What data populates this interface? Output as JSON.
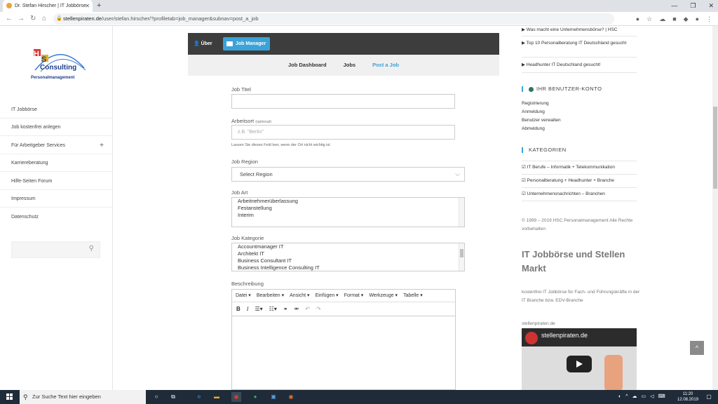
{
  "browser": {
    "tab_title": "Dr. Stefan Hirscher | IT Jobbörse",
    "new_tab": "+",
    "url_host": "stellenpiraten.de",
    "url_path": "/user/stefan.hirscher/?profiletab=job_manager&subnav=post_a_job"
  },
  "left": {
    "logo_top": "HS",
    "logo_main": "Consulting",
    "logo_sub": "Personalmanagement",
    "menu": [
      {
        "label": "IT Jobbörse"
      },
      {
        "label": "Job kostenfrei anlegen"
      },
      {
        "label": "Für Arbeitgeber Services",
        "extra": "+"
      },
      {
        "label": "Karriereberatung"
      },
      {
        "label": "Hilfe-Seiten Forum"
      },
      {
        "label": "Impressum"
      },
      {
        "label": "Datenschutz"
      }
    ]
  },
  "center": {
    "tabs": {
      "ueber": "Über",
      "job_manager": "Job Manager"
    },
    "subnav": {
      "dashboard": "Job Dashboard",
      "jobs": "Jobs",
      "post": "Post a Job"
    },
    "form": {
      "title_label": "Job Titel",
      "location_label": "Arbeitsort",
      "location_optional": "(optional)",
      "location_placeholder": "z.B. \"Berlin\"",
      "location_hint": "Lassen Sie dieses Feld leer, wenn der Ort nicht wichtig ist",
      "region_label": "Job Region",
      "region_value": "Select Region",
      "type_label": "Job Art",
      "type_options": [
        "Arbeitnehmerüberlassung",
        "Festanstellung",
        "Interim"
      ],
      "category_label": "Job Kategorie",
      "category_options": [
        "Accountmanager IT",
        "Architekt IT",
        "Business Consultant IT",
        "Business Intelligence Consulting IT"
      ],
      "description_label": "Beschreibung",
      "editor_menu": [
        "Datei",
        "Bearbeiten",
        "Ansicht",
        "Einfügen",
        "Format",
        "Werkzeuge",
        "Tabelle"
      ]
    }
  },
  "right": {
    "links_top": [
      "▶ Was macht eine Unternehmensbörse? | HSC",
      "▶ Top 10 Personalberatung IT Deutschland gesucht",
      "▶ Headhunter IT Deutschland gesucht!"
    ],
    "account_heading": "IHR BENUTZER-KONTO",
    "account_links": [
      "Registrierung",
      "Anmeldung",
      "Benutzer   verwalten",
      "Abmeldung"
    ],
    "categories_heading": "KATEGORIEN",
    "categories": [
      "☑ IT Berufe – Informatik + Telekommunikation",
      "☑ Personalberatung + Headhunter + Branche",
      "☑ Unternehmensnachrichten – Branchen"
    ],
    "copyright": "© 1999 – 2019 HSC Personalmanagement Alle Rechte vorbehalten",
    "promo_title": "IT Jobbörse und Stellen Markt",
    "promo_desc": "kostenfrei IT Jobbörse für Fach- und Führungskräfte in der IT Branche bzw. EDV-Branche",
    "video_label": "stellenpiraten.de",
    "video_title": "stellenpiraten.de",
    "back_to_top": "^"
  },
  "taskbar": {
    "search_placeholder": "Zur Suche Text hier eingeben",
    "time": "11:20",
    "date": "12.08.2019"
  },
  "colors": {
    "accent": "#3aa3d8",
    "dark_bar": "#3d3d3d",
    "taskbar": "#1f2b38"
  }
}
